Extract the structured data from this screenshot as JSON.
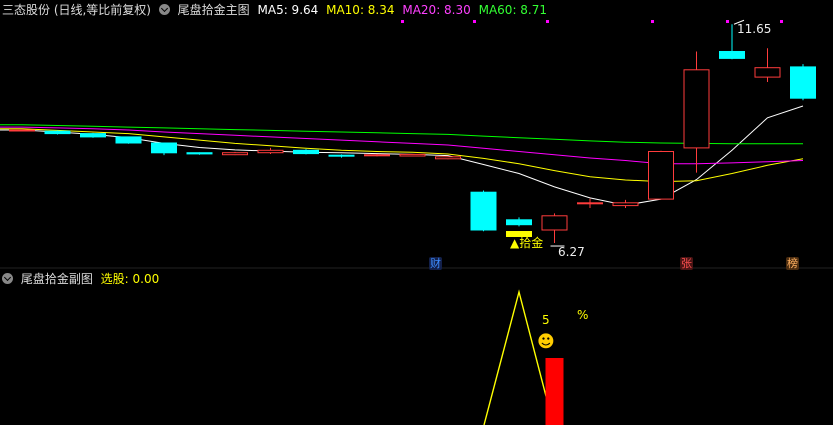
{
  "main_header": {
    "stock": "三态股份 (日线,等比前复权)",
    "indicator": "尾盘拾金主图",
    "ma5": "MA5: 9.64",
    "ma10": "MA10: 8.34",
    "ma20": "MA20: 8.30",
    "ma60": "MA60: 8.71"
  },
  "sub_header": {
    "indicator": "尾盘拾金副图",
    "value": "选股: 0.00"
  },
  "annotations": {
    "high": "11.65",
    "low": "6.27",
    "signal": "▲拾金",
    "badge_cai": "财",
    "badge_zhang": "张",
    "badge_bang": "榜",
    "sub_number": "5",
    "sub_percent": "%",
    "smiley": "☻"
  },
  "colors": {
    "up": "#ff3c3c",
    "down": "#00ffff",
    "ma5": "#ffffff",
    "ma10": "#ffff00",
    "ma20": "#ff00ff",
    "ma60": "#00ff00"
  },
  "chart_data": {
    "type": "candlestick",
    "candles": [
      {
        "open": 9.05,
        "close": 9.05,
        "high": 9.05,
        "low": 9.05
      },
      {
        "open": 9.02,
        "close": 8.96,
        "high": 9.04,
        "low": 8.94
      },
      {
        "open": 8.96,
        "close": 8.88,
        "high": 8.98,
        "low": 8.86
      },
      {
        "open": 8.88,
        "close": 8.73,
        "high": 8.89,
        "low": 8.71
      },
      {
        "open": 8.73,
        "close": 8.49,
        "high": 8.74,
        "low": 8.43
      },
      {
        "open": 8.49,
        "close": 8.46,
        "high": 8.5,
        "low": 8.44
      },
      {
        "open": 8.44,
        "close": 8.49,
        "high": 8.51,
        "low": 8.43
      },
      {
        "open": 8.49,
        "close": 8.55,
        "high": 8.61,
        "low": 8.46
      },
      {
        "open": 8.55,
        "close": 8.47,
        "high": 8.58,
        "low": 8.45
      },
      {
        "open": 8.43,
        "close": 8.42,
        "high": 8.45,
        "low": 8.37
      },
      {
        "open": 8.42,
        "close": 8.44,
        "high": 8.46,
        "low": 8.4
      },
      {
        "open": 8.41,
        "close": 8.45,
        "high": 8.46,
        "low": 8.4
      },
      {
        "open": 8.34,
        "close": 8.39,
        "high": 8.4,
        "low": 8.33
      },
      {
        "open": 7.52,
        "close": 6.59,
        "high": 7.56,
        "low": 6.56
      },
      {
        "open": 6.84,
        "close": 6.72,
        "high": 6.9,
        "low": 6.68
      },
      {
        "open": 6.59,
        "close": 6.94,
        "high": 7.0,
        "low": 6.27
      },
      {
        "open": 7.26,
        "close": 7.26,
        "high": 7.36,
        "low": 7.13
      },
      {
        "open": 7.19,
        "close": 7.26,
        "high": 7.33,
        "low": 7.13
      },
      {
        "open": 7.35,
        "close": 8.52,
        "high": 8.54,
        "low": 7.35
      },
      {
        "open": 8.61,
        "close": 10.53,
        "high": 10.98,
        "low": 8.0
      },
      {
        "open": 10.98,
        "close": 10.81,
        "high": 11.65,
        "low": 10.79
      },
      {
        "open": 10.35,
        "close": 10.58,
        "high": 11.06,
        "low": 10.23
      },
      {
        "open": 10.6,
        "close": 9.83,
        "high": 10.67,
        "low": 9.78
      }
    ],
    "series": [
      {
        "name": "MA5",
        "values": [
          9.05,
          9.0,
          8.94,
          8.86,
          8.72,
          8.62,
          8.56,
          8.53,
          8.5,
          8.49,
          8.47,
          8.45,
          8.42,
          8.2,
          7.98,
          7.65,
          7.38,
          7.2,
          7.35,
          7.83,
          8.55,
          9.35,
          9.64
        ]
      },
      {
        "name": "MA10",
        "values": [
          9.08,
          9.04,
          9.0,
          8.96,
          8.88,
          8.8,
          8.72,
          8.66,
          8.6,
          8.55,
          8.52,
          8.5,
          8.46,
          8.35,
          8.22,
          8.05,
          7.9,
          7.82,
          7.78,
          7.8,
          7.98,
          8.18,
          8.34
        ]
      },
      {
        "name": "MA20",
        "values": [
          9.12,
          9.1,
          9.08,
          9.05,
          9.0,
          8.96,
          8.92,
          8.88,
          8.84,
          8.8,
          8.76,
          8.72,
          8.68,
          8.6,
          8.52,
          8.44,
          8.36,
          8.3,
          8.22,
          8.22,
          8.24,
          8.27,
          8.3
        ]
      },
      {
        "name": "MA60",
        "values": [
          9.18,
          9.16,
          9.14,
          9.12,
          9.1,
          9.08,
          9.06,
          9.04,
          9.02,
          9.0,
          8.98,
          8.96,
          8.94,
          8.9,
          8.86,
          8.82,
          8.78,
          8.75,
          8.73,
          8.72,
          8.71,
          8.71,
          8.71
        ]
      }
    ],
    "sub_series": {
      "name": "选股",
      "values": [
        0,
        0,
        0,
        0,
        0,
        0,
        0,
        0,
        0,
        0,
        0,
        0,
        0,
        0,
        1,
        0,
        0,
        0,
        0,
        0,
        0,
        0,
        0
      ]
    }
  }
}
